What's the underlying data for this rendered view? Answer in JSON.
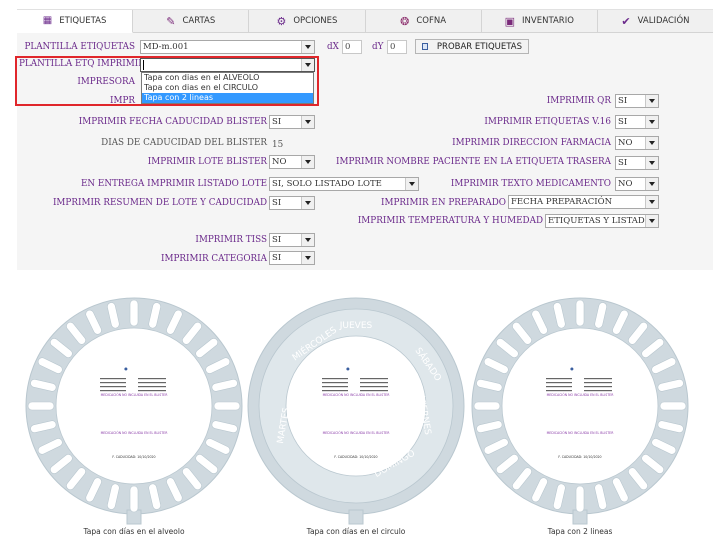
{
  "tabs": [
    {
      "label": "ETIQUETAS",
      "icon": "grid-icon",
      "glyph": "▦",
      "active": true
    },
    {
      "label": "CARTAS",
      "icon": "pencil-icon",
      "glyph": "✎"
    },
    {
      "label": "OPCIONES",
      "icon": "gears-icon",
      "glyph": "⚙"
    },
    {
      "label": "COFNA",
      "icon": "network-icon",
      "glyph": "❂"
    },
    {
      "label": "INVENTARIO",
      "icon": "documents-icon",
      "glyph": "▣"
    },
    {
      "label": "VALIDACIÓN",
      "icon": "check-icon",
      "glyph": "✔"
    }
  ],
  "form": {
    "plantilla_label": "PLANTILLA ETIQUETAS",
    "plantilla_value": "MD-m.001",
    "dx_label": "dX",
    "dx_value": "0",
    "dy_label": "dY",
    "dy_value": "0",
    "probar_label": "PROBAR ETIQUETAS",
    "imprimible_label": "PLANTILLA ETQ IMPRIMIBLE",
    "imprimible_value": "",
    "impresora_label": "IMPRESORA",
    "dropdown_options": [
      "Tapa con dias en el ALVEOLO",
      "Tapa con dias en el CIRCULO",
      "Tapa con 2 lineas"
    ],
    "dropdown_selected": 2,
    "imprimir_partial_label": "IMPR",
    "qr_label": "IMPRIMIR QR",
    "qr_value": "SI",
    "fecha_cad_label": "IMPRIMIR FECHA CADUCIDAD BLISTER",
    "fecha_cad_value": "SI",
    "etq_v16_label": "IMPRIMIR ETIQUETAS V.16",
    "etq_v16_value": "SI",
    "dias_cad_label": "DIAS DE CADUCIDAD DEL BLISTER",
    "dias_cad_value": "15",
    "direccion_label": "IMPRIMIR DIRECCION FARMACIA",
    "direccion_value": "NO",
    "lote_blister_label": "IMPRIMIR LOTE BLISTER",
    "lote_blister_value": "NO",
    "nombre_paciente_label": "IMPRIMIR NOMBRE PACIENTE EN LA ETIQUETA TRASERA",
    "nombre_paciente_value": "SI",
    "entrega_label": "EN ENTREGA IMPRIMIR LISTADO LOTE",
    "entrega_value": "SI, SOLO LISTADO LOTE",
    "texto_med_label": "IMPRIMIR TEXTO MEDICAMENTO",
    "texto_med_value": "NO",
    "resumen_label": "IMPRIMIR RESUMEN DE LOTE Y CADUCIDAD",
    "resumen_value": "SI",
    "preparado_label": "IMPRIMIR EN PREPARADO",
    "preparado_value": "FECHA PREPARACIÓN",
    "temp_label": "IMPRIMIR TEMPERATURA Y HUMEDAD",
    "temp_value": "ETIQUETAS Y LISTADO",
    "tiss_label": "IMPRIMIR TISS",
    "tiss_value": "SI",
    "categoria_label": "IMPRIMIR CATEGORIA",
    "categoria_value": "SI"
  },
  "wheels": [
    {
      "caption": "Tapa con días en el alveolo",
      "purple_text": "MEDICACIÓN NO INCLUIDA EN EL BLISTER",
      "expiry": "F. CADUCIDAD: 10/10/2020"
    },
    {
      "caption": "Tapa con días en el circulo",
      "purple_text": "MEDICACIÓN NO INCLUIDA EN EL BLISTER",
      "expiry": "F. CADUCIDAD: 10/10/2020",
      "days": [
        "JUEVES",
        "SÁBADO",
        "MIÉRCOLES",
        "LUNES",
        "MARTES",
        "DOMINGO",
        "VIERNES"
      ]
    },
    {
      "caption": "Tapa con 2 lineas",
      "purple_text": "MEDICACIÓN NO INCLUIDA EN EL BLISTER",
      "expiry": "F. CADUCIDAD: 10/10/2020"
    }
  ],
  "colors": {
    "label": "#6b2a8b",
    "highlight": "#3399ff",
    "red_box": "#e0262b",
    "wheel": "#cfd9df",
    "wheel_line": "#b9c7cf"
  }
}
